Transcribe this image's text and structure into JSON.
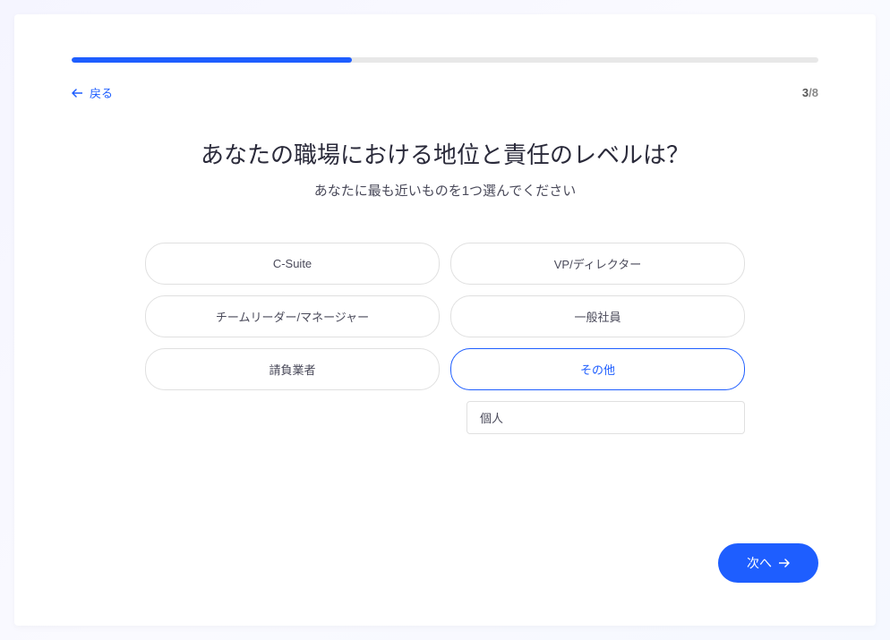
{
  "progress": {
    "current": 3,
    "total": 8,
    "percent": 37.5
  },
  "nav": {
    "back_label": "戻る",
    "next_label": "次へ"
  },
  "question": {
    "title": "あなたの職場における地位と責任のレベルは？",
    "subtitle": "あなたに最も近いものを1つ選んでください"
  },
  "options": [
    {
      "label": "C-Suite",
      "selected": false
    },
    {
      "label": "VP/ディレクター",
      "selected": false
    },
    {
      "label": "チームリーダー/マネージャー",
      "selected": false
    },
    {
      "label": "一般社員",
      "selected": false
    },
    {
      "label": "請負業者",
      "selected": false
    },
    {
      "label": "その他",
      "selected": true
    }
  ],
  "other_input": {
    "value": "個人"
  }
}
